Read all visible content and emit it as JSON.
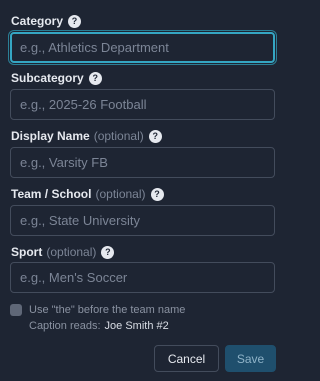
{
  "fields": [
    {
      "label": "Category",
      "optional": "",
      "placeholder": "e.g., Athletics Department",
      "value": ""
    },
    {
      "label": "Subcategory",
      "optional": "",
      "placeholder": "e.g., 2025-26 Football",
      "value": ""
    },
    {
      "label": "Display Name",
      "optional": "(optional)",
      "placeholder": "e.g., Varsity FB",
      "value": ""
    },
    {
      "label": "Team / School",
      "optional": "(optional)",
      "placeholder": "e.g., State University",
      "value": ""
    },
    {
      "label": "Sport",
      "optional": "(optional)",
      "placeholder": "e.g., Men's Soccer",
      "value": ""
    }
  ],
  "help_glyph": "?",
  "icons": {
    "help": "question-circle-icon",
    "checkbox": "checkbox-unchecked"
  },
  "the_option": {
    "label": "Use \"the\" before the team name",
    "checked": false
  },
  "caption": {
    "label": "Caption reads:",
    "value": "Joe Smith #2"
  },
  "buttons": {
    "cancel": "Cancel",
    "save": "Save"
  },
  "colors": {
    "background": "#1e2533",
    "focus_ring": "#35a6c3",
    "save_button": "#1f4f6d"
  }
}
